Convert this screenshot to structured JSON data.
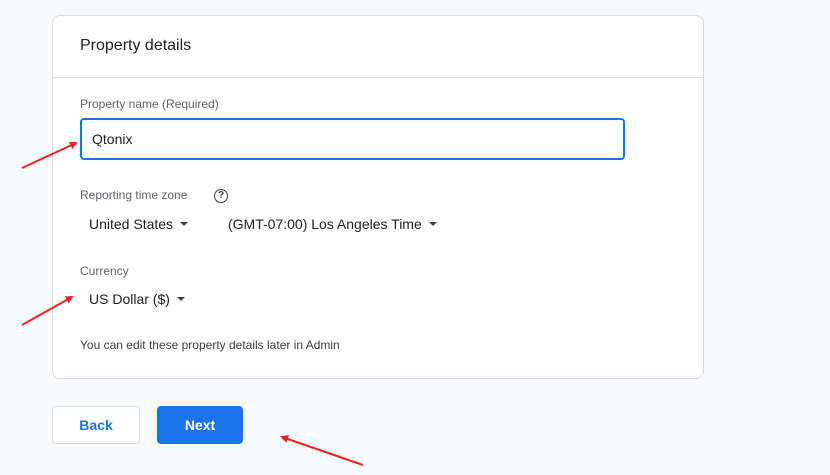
{
  "card": {
    "title": "Property details",
    "property_name": {
      "label": "Property name (Required)",
      "value": "Qtonix"
    },
    "time_zone": {
      "label": "Reporting time zone",
      "help_icon": "help-circle-icon",
      "country": "United States",
      "zone": "(GMT-07:00) Los Angeles Time"
    },
    "currency": {
      "label": "Currency",
      "value": "US Dollar ($)"
    },
    "hint": "You can edit these property details later in Admin"
  },
  "buttons": {
    "back": "Back",
    "next": "Next"
  },
  "colors": {
    "accent": "#1a73e8",
    "annotation": "#e8261f"
  }
}
